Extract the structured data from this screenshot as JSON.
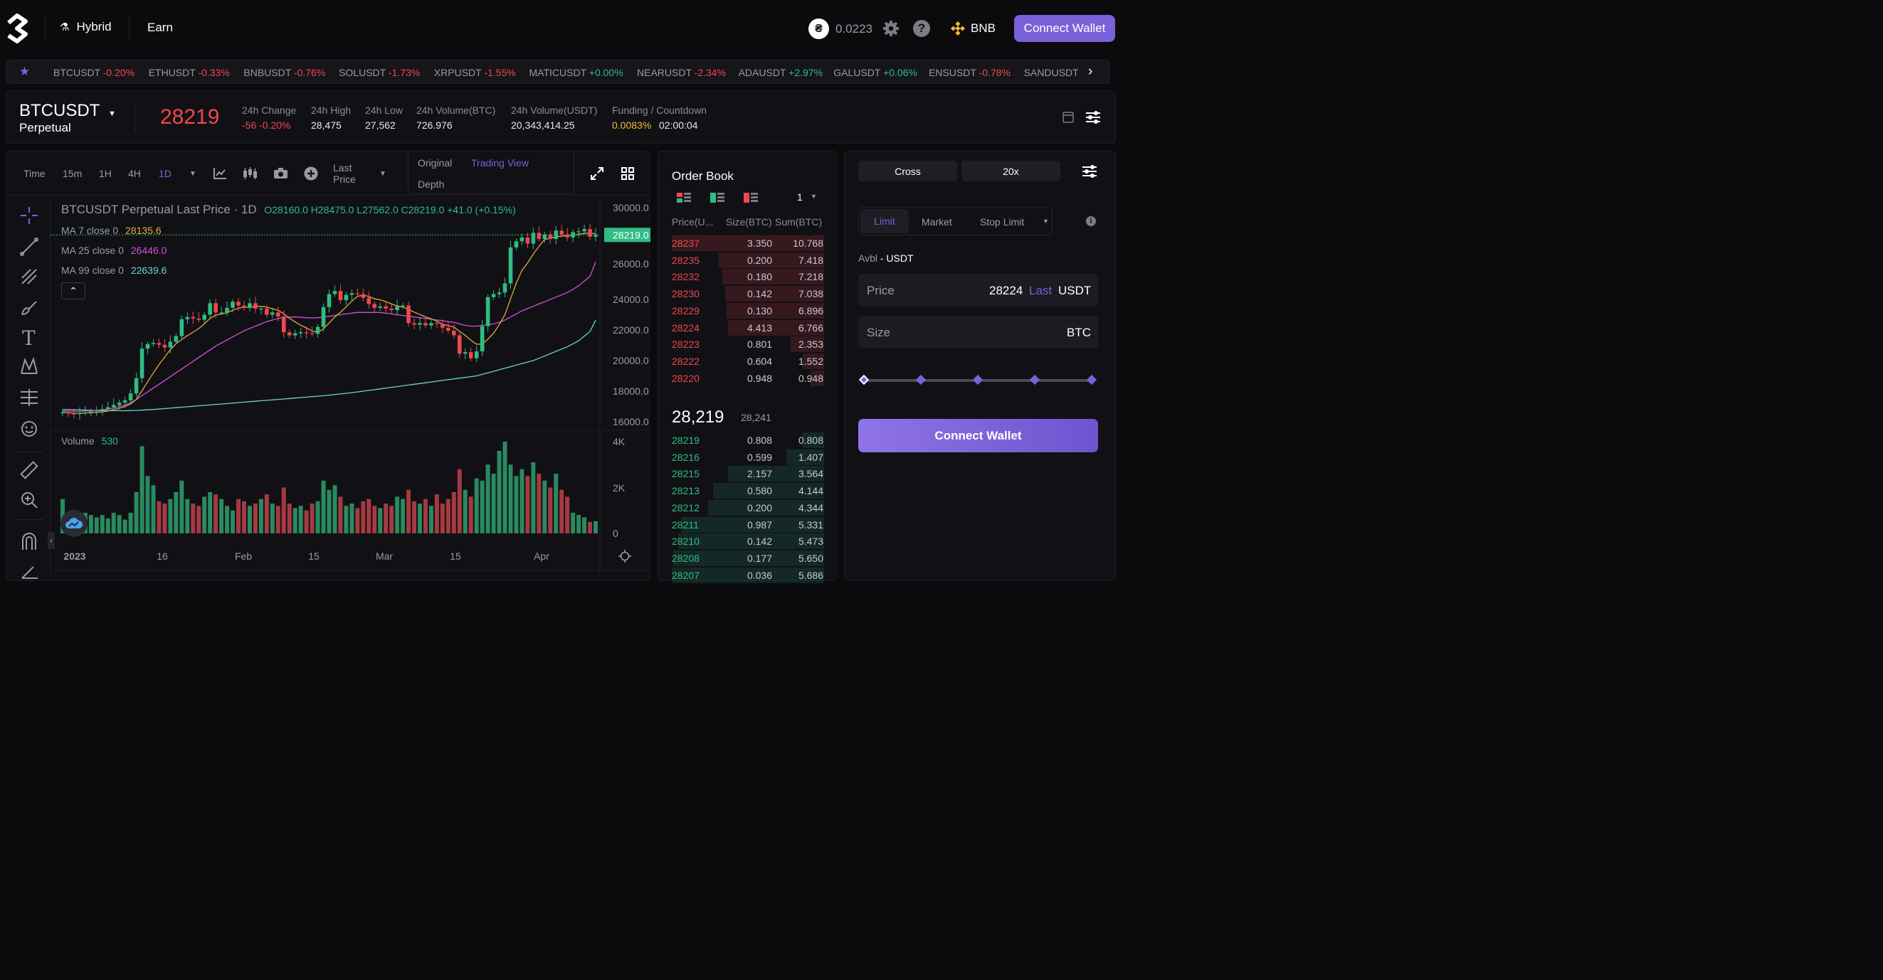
{
  "header": {
    "nav": [
      {
        "label": "Hybrid"
      },
      {
        "label": "Earn"
      }
    ],
    "balance": "0.0223",
    "network": "BNB",
    "connect_label": "Connect Wallet"
  },
  "ticker": [
    {
      "pair": "BTCUSDT",
      "change": "-0.20%",
      "dir": "neg"
    },
    {
      "pair": "ETHUSDT",
      "change": "-0.33%",
      "dir": "neg"
    },
    {
      "pair": "BNBUSDT",
      "change": "-0.76%",
      "dir": "neg"
    },
    {
      "pair": "SOLUSDT",
      "change": "-1.73%",
      "dir": "neg"
    },
    {
      "pair": "XRPUSDT",
      "change": "-1.55%",
      "dir": "neg"
    },
    {
      "pair": "MATICUSDT",
      "change": "+0.00%",
      "dir": "pos"
    },
    {
      "pair": "NEARUSDT",
      "change": "-2.34%",
      "dir": "neg"
    },
    {
      "pair": "ADAUSDT",
      "change": "+2.97%",
      "dir": "pos"
    },
    {
      "pair": "GALUSDT",
      "change": "+0.06%",
      "dir": "pos"
    },
    {
      "pair": "ENSUSDT",
      "change": "-0.78%",
      "dir": "neg"
    },
    {
      "pair": "SANDUSDT",
      "change": "",
      "dir": "neg"
    }
  ],
  "market": {
    "symbol": "BTCUSDT",
    "kind": "Perpetual",
    "price": "28219",
    "stats": [
      {
        "label": "24h Change",
        "value": "-56 -0.20%",
        "color": "#f0474f"
      },
      {
        "label": "24h High",
        "value": "28,475",
        "color": "#e8e8ec"
      },
      {
        "label": "24h Low",
        "value": "27,562",
        "color": "#e8e8ec"
      },
      {
        "label": "24h Volume(BTC)",
        "value": "726.976",
        "color": "#e8e8ec"
      },
      {
        "label": "24h Volume(USDT)",
        "value": "20,343,414.25",
        "color": "#e8e8ec"
      }
    ],
    "funding_label": "Funding / Countdown",
    "funding_rate": "0.0083%",
    "countdown": "02:00:04"
  },
  "chart_toolbar": {
    "time": "Time",
    "intervals": [
      "15m",
      "1H",
      "4H",
      "1D"
    ],
    "active": "1D",
    "price_type": "Last Price",
    "views": [
      "Original",
      "Trading View",
      "Depth"
    ],
    "active_view": "Trading View"
  },
  "chart_legend": {
    "title": "BTCUSDT Perpetual Last Price · 1D",
    "ohlc": "O28160.0 H28475.0 L27562.0 C28219.0 +41.0 (+0.15%)",
    "ma7_label": "MA 7 close 0",
    "ma7": "28135.6",
    "ma25_label": "MA 25 close 0",
    "ma25": "26446.0",
    "ma99_label": "MA 99 close 0",
    "ma99": "22639.6",
    "volume_label": "Volume",
    "volume": "530",
    "last_price_tag": "28219.0"
  },
  "chart_data": {
    "type": "candlestick",
    "title": "BTCUSDT Perpetual Last Price · 1D",
    "x_ticks": [
      "2023",
      "16",
      "Feb",
      "15",
      "Mar",
      "15",
      "Apr"
    ],
    "y_ticks": [
      "30000.0",
      "26000.0",
      "24000.0",
      "22000.0",
      "20000.0",
      "18000.0",
      "16000.0"
    ],
    "volume_ticks": [
      "4K",
      "2K",
      "0"
    ],
    "ylim": [
      16000,
      30000
    ],
    "closes": [
      16620,
      16540,
      16500,
      16580,
      16610,
      16680,
      16760,
      16830,
      16950,
      17100,
      17250,
      17400,
      17850,
      18850,
      20780,
      21080,
      21150,
      21030,
      20860,
      21230,
      21600,
      22700,
      22850,
      22750,
      22670,
      23000,
      23750,
      23150,
      23150,
      23450,
      23850,
      23600,
      23450,
      23750,
      23400,
      23400,
      23000,
      23150,
      22880,
      21850,
      21650,
      21780,
      21850,
      21800,
      21750,
      22200,
      23500,
      24350,
      24550,
      23950,
      24300,
      24400,
      24350,
      24100,
      23700,
      23450,
      23550,
      23400,
      23300,
      23550,
      23600,
      22450,
      22350,
      22450,
      22300,
      22450,
      22400,
      22150,
      21950,
      21650,
      20450,
      20550,
      20150,
      20600,
      22250,
      24150,
      24350,
      24450,
      25050,
      27400,
      27800,
      28050,
      27650,
      28350,
      27950,
      28250,
      27950,
      28500,
      28250,
      28050,
      28400,
      28450,
      28600,
      28100,
      28219
    ],
    "volumes": [
      1500,
      800,
      700,
      850,
      900,
      800,
      700,
      800,
      650,
      900,
      800,
      600,
      900,
      1800,
      3800,
      2500,
      2100,
      1400,
      1300,
      1500,
      1800,
      2300,
      1500,
      1300,
      1200,
      1600,
      1800,
      1700,
      1500,
      1200,
      1000,
      1500,
      1400,
      1200,
      1300,
      1500,
      1700,
      1300,
      1200,
      2000,
      1300,
      1100,
      1200,
      1000,
      1300,
      1400,
      2300,
      1900,
      2100,
      1600,
      1200,
      1300,
      1100,
      1400,
      1500,
      1200,
      1100,
      1300,
      1200,
      1600,
      1500,
      1900,
      1400,
      1300,
      1500,
      1200,
      1700,
      1300,
      1500,
      1800,
      2800,
      1900,
      1600,
      2400,
      2300,
      3000,
      2600,
      3600,
      4000,
      3000,
      2500,
      2800,
      2500,
      3100,
      2600,
      2300,
      2000,
      2600,
      1900,
      1600,
      900,
      800,
      700,
      500,
      530
    ],
    "ma25": [
      16700,
      16690,
      16680,
      16680,
      16700,
      16720,
      16740,
      16780,
      16820,
      16900,
      17000,
      17100,
      17250,
      17450,
      17700,
      17950,
      18200,
      18450,
      18700,
      18950,
      19200,
      19450,
      19700,
      19950,
      20200,
      20450,
      20700,
      20950,
      21150,
      21350,
      21550,
      21750,
      21950,
      22100,
      22250,
      22400,
      22550,
      22650,
      22750,
      22820,
      22850,
      22850,
      22830,
      22800,
      22780,
      22800,
      22850,
      22900,
      22950,
      23000,
      23050,
      23100,
      23150,
      23150,
      23150,
      23150,
      23150,
      23100,
      23050,
      23000,
      22950,
      22900,
      22850,
      22800,
      22750,
      22700,
      22650,
      22600,
      22550,
      22500,
      22400,
      22300,
      22250,
      22250,
      22300,
      22350,
      22400,
      22500,
      22650,
      22850,
      23050,
      23250,
      23400,
      23550,
      23700,
      23850,
      24000,
      24150,
      24300,
      24450,
      24650,
      24900,
      25200,
      25500,
      26446
    ],
    "ma99": [
      16800,
      16790,
      16780,
      16770,
      16760,
      16750,
      16740,
      16730,
      16720,
      16720,
      16720,
      16720,
      16730,
      16740,
      16760,
      16780,
      16800,
      16830,
      16860,
      16890,
      16920,
      16950,
      16980,
      17010,
      17040,
      17070,
      17100,
      17130,
      17160,
      17190,
      17220,
      17250,
      17280,
      17310,
      17340,
      17370,
      17400,
      17430,
      17460,
      17490,
      17520,
      17550,
      17580,
      17610,
      17640,
      17670,
      17700,
      17740,
      17780,
      17820,
      17860,
      17900,
      17950,
      18000,
      18050,
      18100,
      18150,
      18200,
      18250,
      18300,
      18350,
      18400,
      18450,
      18500,
      18550,
      18600,
      18650,
      18700,
      18750,
      18800,
      18850,
      18900,
      18950,
      19000,
      19100,
      19200,
      19300,
      19400,
      19500,
      19600,
      19700,
      19800,
      19900,
      20000,
      20150,
      20300,
      20450,
      20600,
      20750,
      20900,
      21100,
      21300,
      21600,
      21900,
      22639.6
    ]
  },
  "order_book": {
    "title": "Order Book",
    "precision": "1",
    "headers": [
      "Price(U...",
      "Size(BTC)",
      "Sum(BTC)"
    ],
    "asks": [
      [
        "28237",
        "3.350",
        "10.768"
      ],
      [
        "28235",
        "0.200",
        "7.418"
      ],
      [
        "28232",
        "0.180",
        "7.218"
      ],
      [
        "28230",
        "0.142",
        "7.038"
      ],
      [
        "28229",
        "0.130",
        "6.896"
      ],
      [
        "28224",
        "4.413",
        "6.766"
      ],
      [
        "28223",
        "0.801",
        "2.353"
      ],
      [
        "28222",
        "0.604",
        "1.552"
      ],
      [
        "28220",
        "0.948",
        "0.948"
      ]
    ],
    "last": "28,219",
    "mark": "28,241",
    "bids": [
      [
        "28219",
        "0.808",
        "0.808"
      ],
      [
        "28216",
        "0.599",
        "1.407"
      ],
      [
        "28215",
        "2.157",
        "3.564"
      ],
      [
        "28213",
        "0.580",
        "4.144"
      ],
      [
        "28212",
        "0.200",
        "4.344"
      ],
      [
        "28211",
        "0.987",
        "5.331"
      ],
      [
        "28210",
        "0.142",
        "5.473"
      ],
      [
        "28208",
        "0.177",
        "5.650"
      ],
      [
        "28207",
        "0.036",
        "5.686"
      ]
    ],
    "ask_depth": [
      1.0,
      0.69,
      0.67,
      0.65,
      0.64,
      0.63,
      0.22,
      0.14,
      0.09
    ],
    "bid_depth": [
      0.14,
      0.25,
      0.63,
      0.73,
      0.76,
      0.94,
      0.96,
      0.99,
      1.0
    ]
  },
  "trade": {
    "margin": "Cross",
    "leverage": "20x",
    "tabs": [
      "Limit",
      "Market",
      "Stop Limit"
    ],
    "active_tab": "Limit",
    "avbl_label": "Avbl",
    "avbl_value": "- USDT",
    "price_label": "Price",
    "price_value": "28224",
    "price_last": "Last",
    "price_unit": "USDT",
    "size_label": "Size",
    "size_unit": "BTC",
    "slider_level": 0,
    "connect_label": "Connect Wallet"
  }
}
